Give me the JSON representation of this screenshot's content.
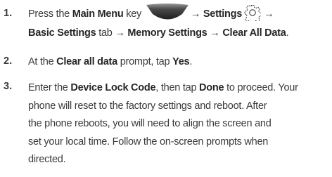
{
  "steps": [
    {
      "number": "1.",
      "line1": {
        "t1": "Press the ",
        "main_menu": "Main Menu",
        "t2": " key ",
        "arrow1": "→",
        "settings": "Settings",
        "arrow2": "→"
      },
      "line2": {
        "basic_settings": "Basic Settings",
        "t1": " tab ",
        "arrow1": "→",
        "memory_settings": "Memory Settings",
        "arrow2": "→",
        "clear_all_data": "Clear All Data",
        "t2": "."
      },
      "icons": {
        "menu_key": "main-menu-key-icon",
        "settings": "gear-icon"
      }
    },
    {
      "number": "2.",
      "t1": "At the ",
      "prompt_name": "Clear all data",
      "t2": " prompt, tap ",
      "yes": "Yes",
      "t3": "."
    },
    {
      "number": "3.",
      "line1": {
        "t1": "Enter the ",
        "device_lock_code": "Device Lock Code",
        "t2": ", then tap ",
        "done": "Done",
        "t3": " to proceed. Your"
      },
      "line2": "phone will reset to the factory settings and reboot. After",
      "line3": "the phone reboots, you will need to align the screen and",
      "line4": "set your local time. Follow the on-screen prompts when",
      "line5": "directed."
    }
  ],
  "colors": {
    "text": "#3a3a3a",
    "bold_text": "#262626",
    "menu_key_dark": "#2b2b2b",
    "menu_key_light": "#8a8a8a"
  }
}
